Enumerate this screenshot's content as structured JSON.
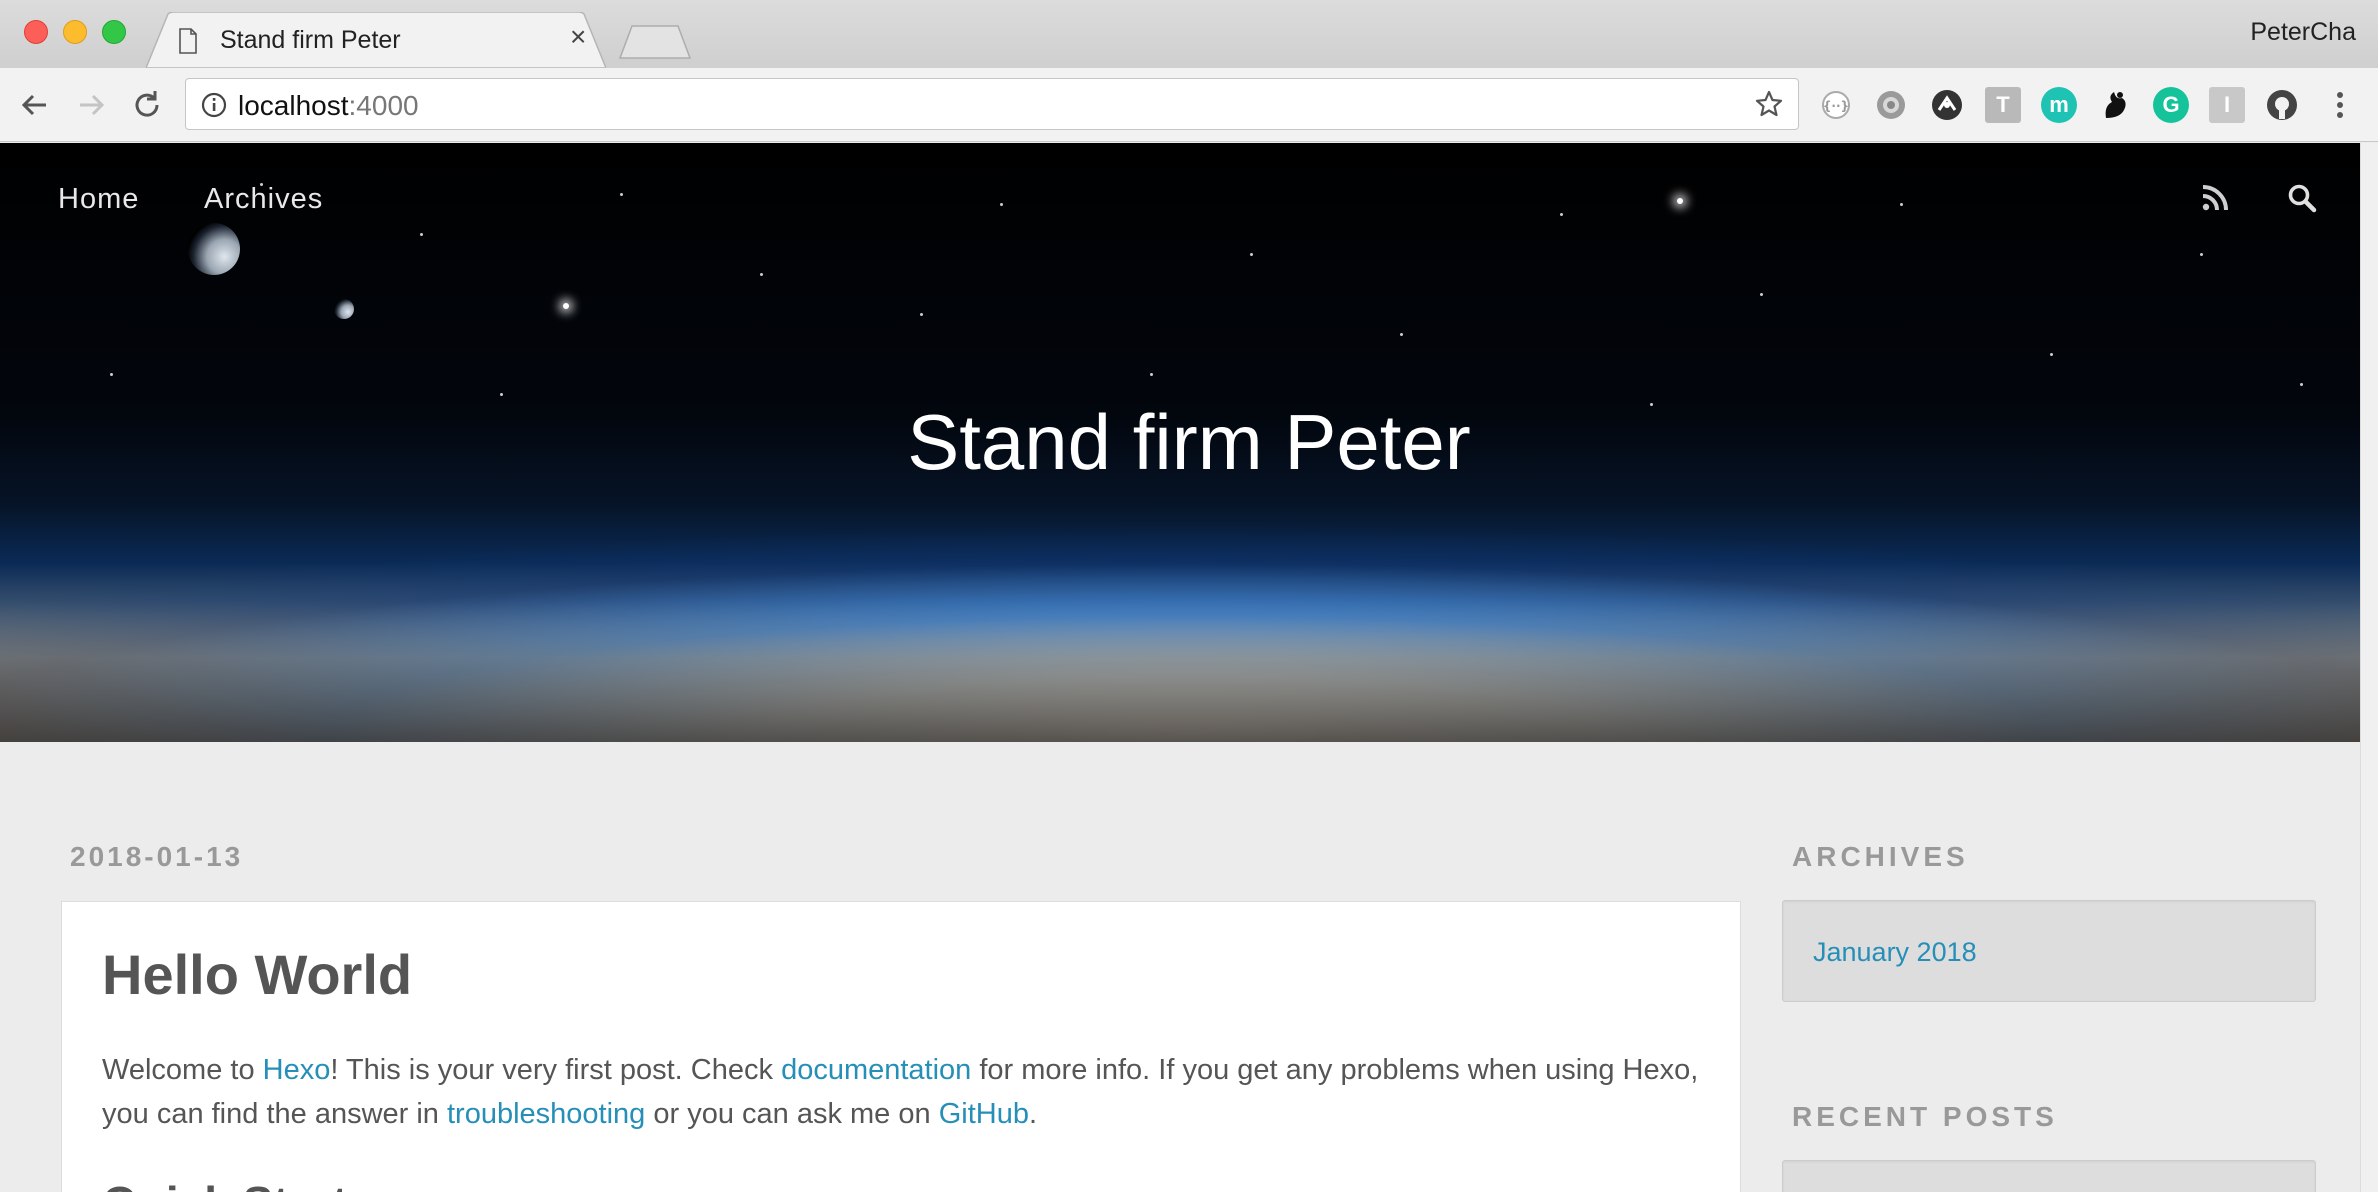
{
  "browser": {
    "tab_title": "Stand firm Peter",
    "profile_name": "PeterCha",
    "url_host": "localhost",
    "url_port": ":4000",
    "extensions": [
      "privacy-badger-icon",
      "gear-extension-icon",
      "speed-extension-icon",
      "t-extension-icon",
      "m-extension-icon",
      "gnome-extension-icon",
      "grammarly-icon",
      "i-extension-icon",
      "github-icon"
    ]
  },
  "site": {
    "nav": {
      "home": "Home",
      "archives": "Archives"
    },
    "title": "Stand firm Peter"
  },
  "post": {
    "date": "2018-01-13",
    "title": "Hello World",
    "body": {
      "t1": "Welcome to ",
      "link_hexo": "Hexo",
      "t2": "! This is your very first post. Check ",
      "link_docs": "documentation",
      "t3": " for more info. If you get any problems when using Hexo, you can find the answer in ",
      "link_troubleshooting": "troubleshooting",
      "t4": " or you can ask me on ",
      "link_github": "GitHub",
      "t5": "."
    },
    "subheading": "Quick Start"
  },
  "sidebar": {
    "archives_title": "ARCHIVES",
    "archives_link": "January 2018",
    "recent_title": "RECENT POSTS"
  },
  "colors": {
    "link": "#258fb8",
    "muted": "#999999",
    "page_bg": "#ececec"
  }
}
